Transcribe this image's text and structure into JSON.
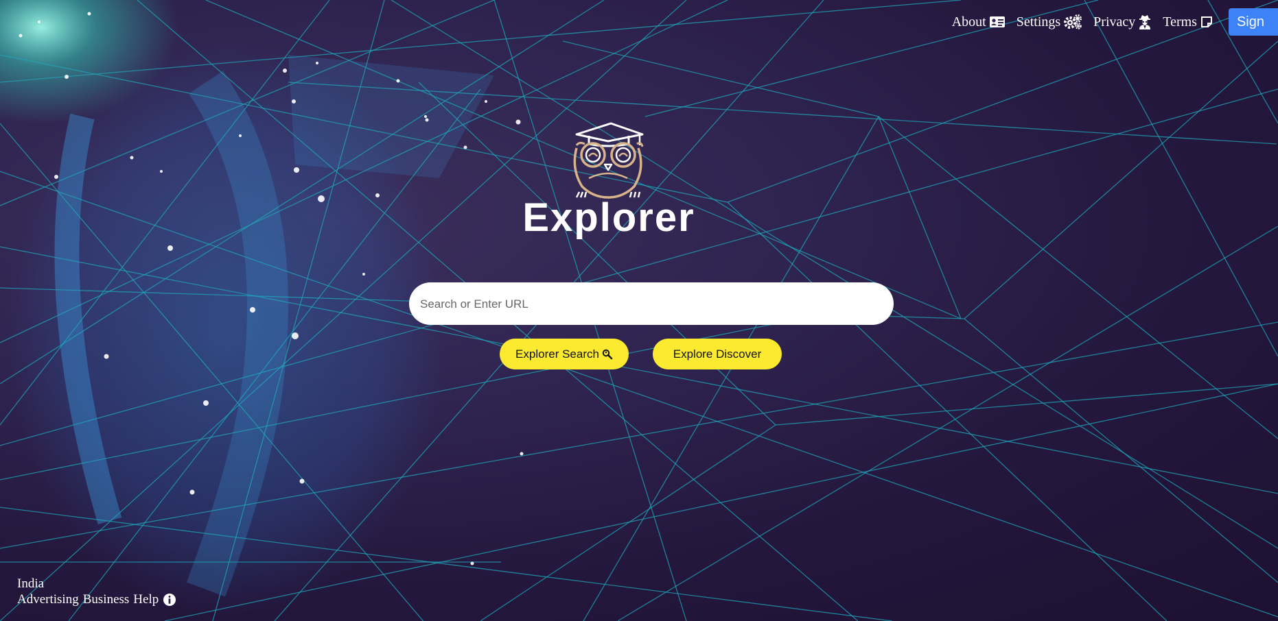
{
  "nav": {
    "about_label": "About",
    "settings_label": "Settings",
    "privacy_label": "Privacy",
    "terms_label": "Terms",
    "sign_label": "Sign"
  },
  "logo": {
    "text": "Explorer"
  },
  "search": {
    "placeholder": "Search or Enter URL",
    "value": ""
  },
  "buttons": {
    "search_label": "Explorer Search",
    "discover_label": "Explore Discover"
  },
  "footer": {
    "country": "India",
    "advertising": "Advertising",
    "business": "Business",
    "help": "Help"
  },
  "icons": {
    "about": "id-card-icon",
    "settings": "gears-icon",
    "privacy": "user-secret-icon",
    "terms": "sticky-note-icon",
    "search": "magnifier-icon",
    "info": "info-circle-icon"
  },
  "colors": {
    "accent_yellow": "#fbea2f",
    "sign_blue": "#3e82f7",
    "background": "#2f2450",
    "line_cyan": "#1fa6b8"
  }
}
